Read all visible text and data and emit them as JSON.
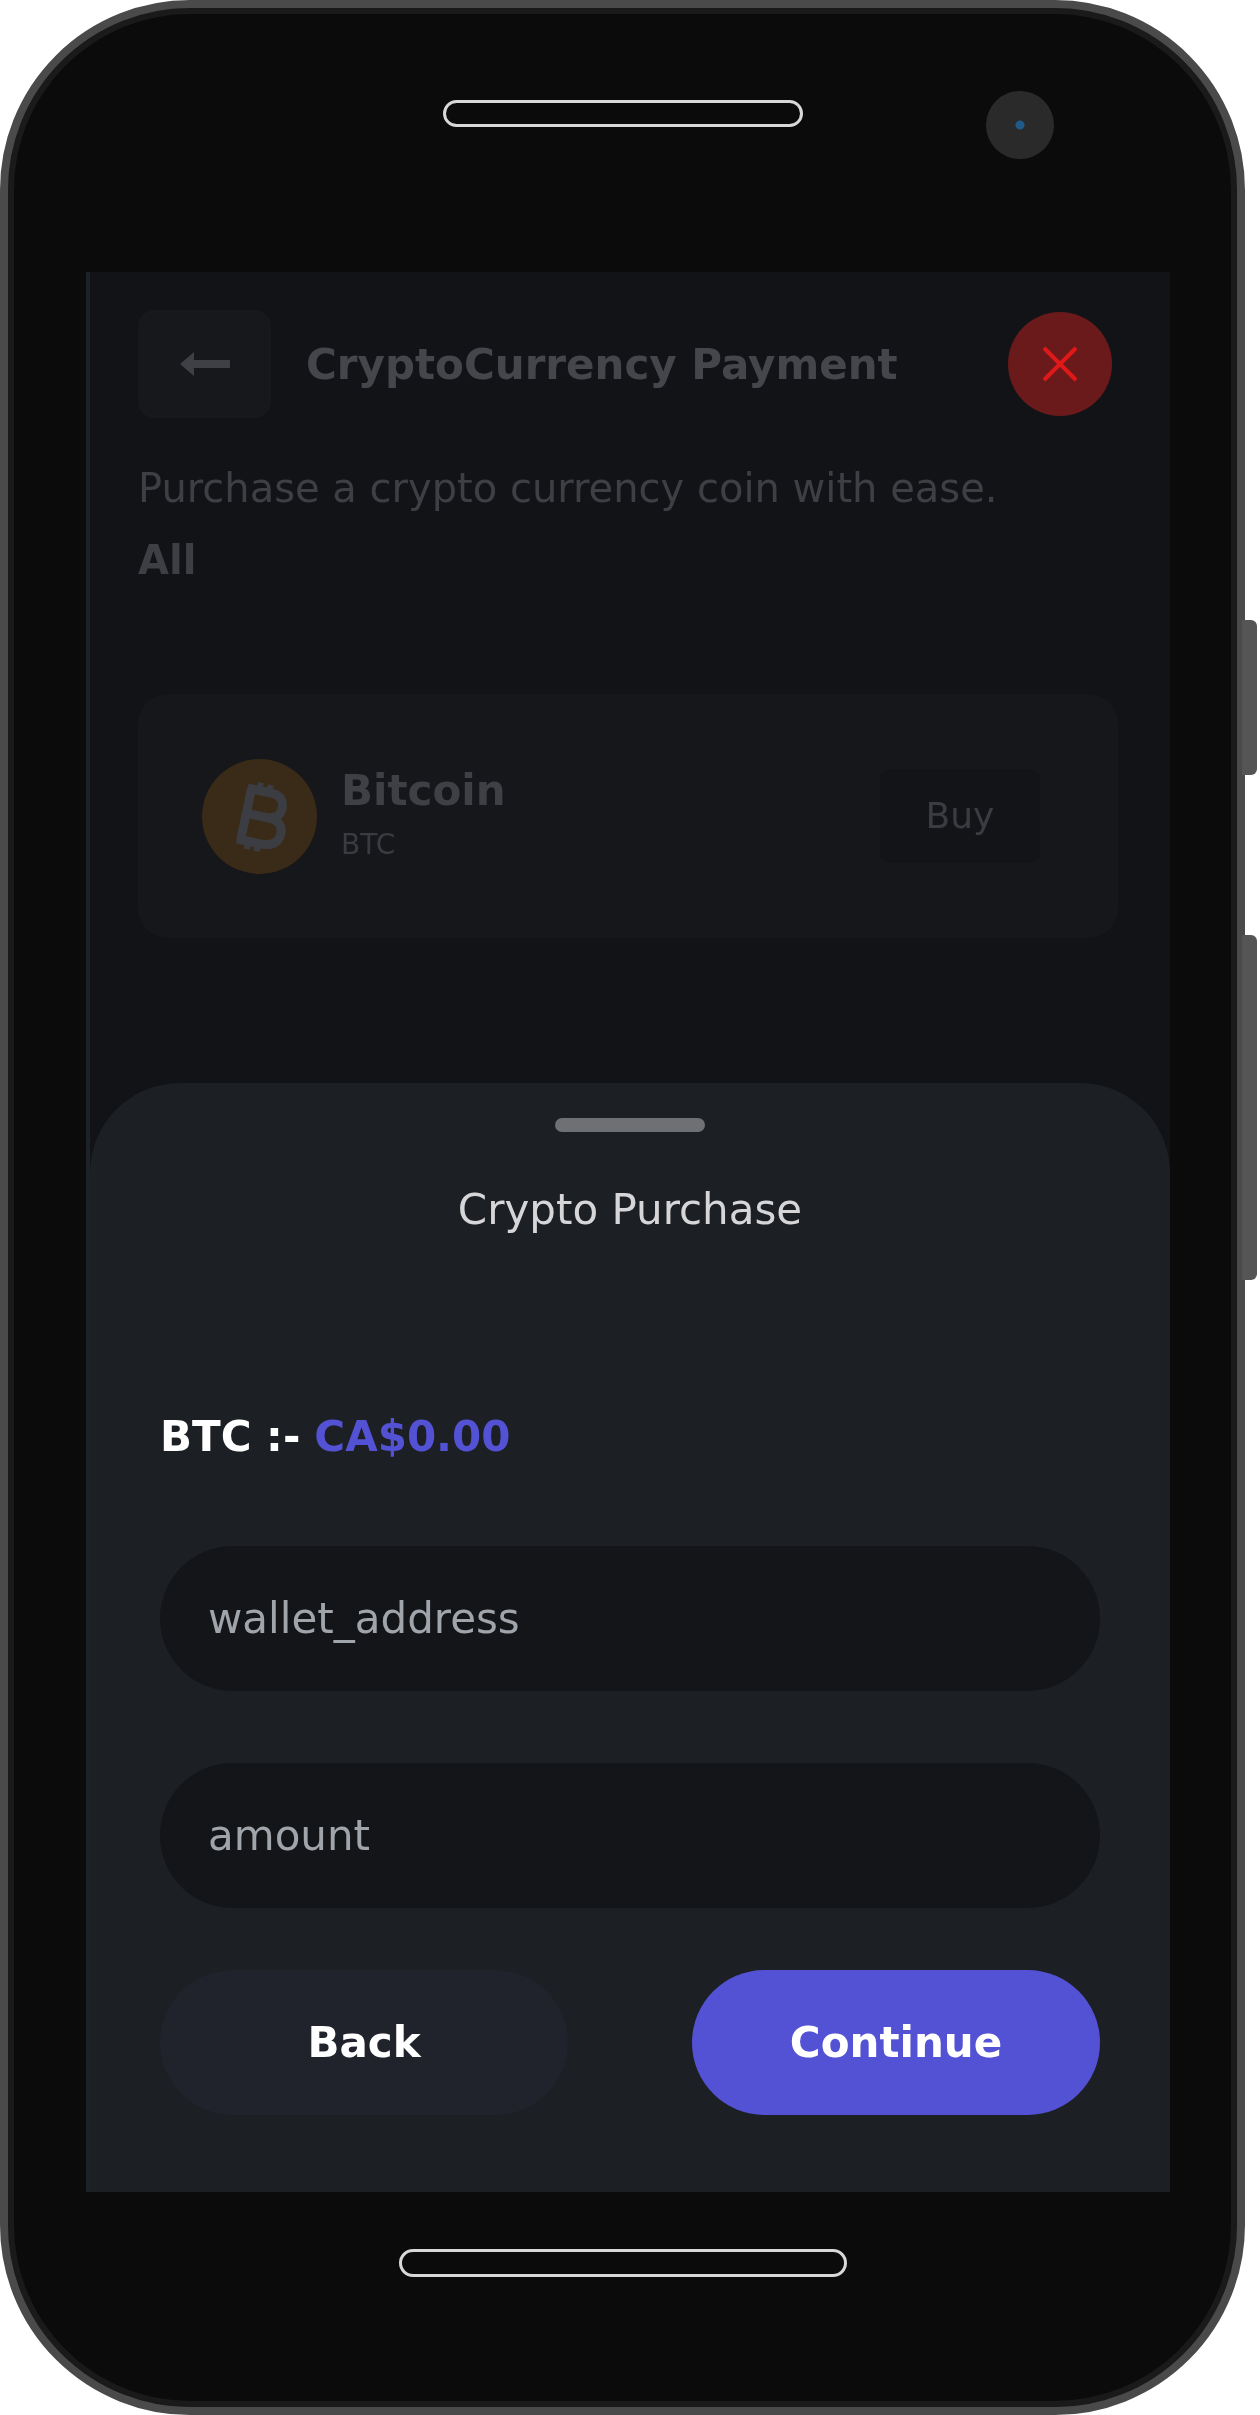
{
  "header": {
    "title": "CryptoCurrency Payment"
  },
  "description": "Purchase a crypto currency coin with ease.",
  "filter": "All",
  "coins": [
    {
      "name": "Bitcoin",
      "symbol": "BTC",
      "action": "Buy"
    }
  ],
  "sheet": {
    "title": "Crypto Purchase",
    "rate": {
      "label": "BTC :-",
      "price": "CA$0.00"
    },
    "fields": [
      {
        "placeholder": "wallet_address"
      },
      {
        "placeholder": "amount"
      }
    ],
    "buttons": [
      {
        "label": "Back",
        "kind": "secondary"
      },
      {
        "label": "Continue",
        "kind": "primary"
      }
    ]
  }
}
